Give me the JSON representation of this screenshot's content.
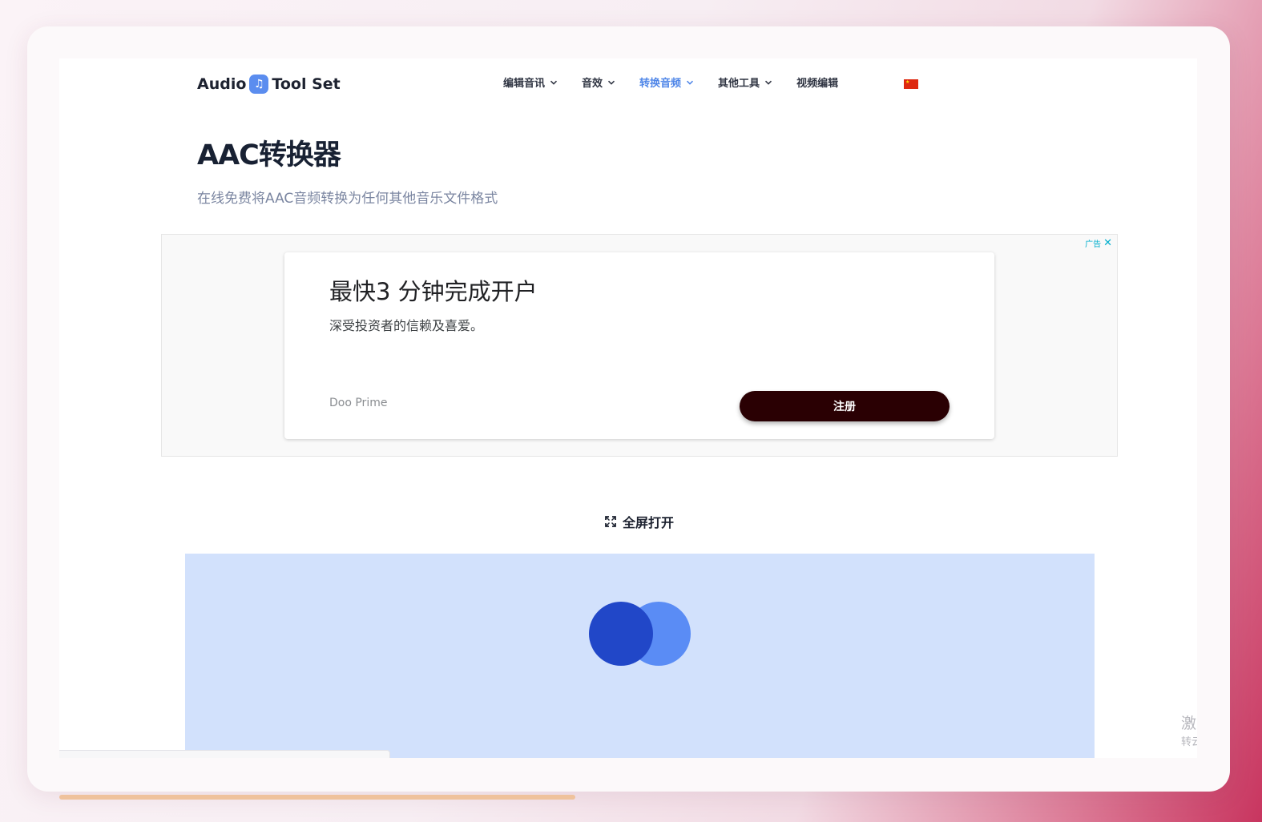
{
  "header": {
    "logo_left": "Audio",
    "logo_right": "Tool Set",
    "nav": [
      {
        "label": "编辑音讯",
        "active": false
      },
      {
        "label": "音效",
        "active": false
      },
      {
        "label": "转换音频",
        "active": true
      },
      {
        "label": "其他工具",
        "active": false
      }
    ],
    "nav_plain": "视频编辑",
    "flag_icon": "china-flag-icon"
  },
  "main": {
    "title": "AAC转换器",
    "subtitle": "在线免费将AAC音频转换为任何其他音乐文件格式"
  },
  "ad": {
    "badge_label": "广告",
    "headline": "最快3 分钟完成开户",
    "body": "深受投资者的信赖及喜爱。",
    "advertiser": "Doo Prime",
    "cta": "注册"
  },
  "tool": {
    "fullscreen_label": "全屏打开",
    "loading_colors": [
      "#2147c8",
      "#5a8cf5"
    ]
  },
  "side_widget": {
    "big": "激",
    "small": "转云"
  },
  "colors": {
    "accent": "#4f86e8",
    "tool_bg": "#d2e1fc",
    "cta_bg": "#2a0003"
  }
}
